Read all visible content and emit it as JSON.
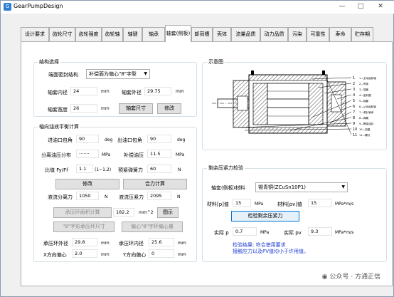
{
  "window": {
    "title": "GearPumpDesign"
  },
  "tabs": [
    "设计要求",
    "齿轮尺寸",
    "齿轮强度",
    "齿轮轴",
    "轴键",
    "轴承",
    "轴套(侧板)",
    "卸荷槽",
    "壳体",
    "流量品质",
    "动力品质",
    "污染",
    "可靠性",
    "寿命",
    "贮存期"
  ],
  "active_tab": "轴套(侧板)",
  "structure": {
    "title": "结构选择",
    "seal_label": "端面密封结构",
    "seal_value": "补偿面为偏心\"8\"字型",
    "inner_diameter_label": "轴套内径",
    "inner_diameter_value": "24",
    "inner_diameter_unit": "mm",
    "outer_diameter_label": "轴套外径",
    "outer_diameter_value": "29.75",
    "outer_diameter_unit": "mm",
    "width_label": "轴套宽度",
    "width_value": "26",
    "width_unit": "mm",
    "size_button": "轴套尺寸",
    "modify_button": "修改"
  },
  "balance": {
    "title": "轴向油液平衡计算",
    "inlet_angle_label": "进油口包角",
    "inlet_angle_value": "90",
    "inlet_angle_unit": "deg",
    "outlet_angle_label": "出油口包角",
    "outlet_angle_value": "90",
    "outlet_angle_unit": "deg",
    "dist_label": "分离油压分布",
    "dist_value": "·······",
    "dist_unit": "MPa",
    "comp_pressure_label": "补偿油压",
    "comp_pressure_value": "11.5",
    "comp_pressure_unit": "MPa",
    "ratio_label": "比值  Fy/Ff",
    "ratio_value": "1.1",
    "ratio_range": "(1~1.2)",
    "spring_label": "预紧弹簧力",
    "spring_value": "60",
    "spring_unit": "N",
    "modify_button": "修改",
    "calc_button": "合力计算",
    "sep_force_label": "液流分离力",
    "sep_force_value": "1050",
    "sep_force_unit": "N",
    "press_force_label": "液流压紧力",
    "press_force_value": "2095",
    "press_force_unit": "N",
    "area_button": "承压环面积计算",
    "area_value": "182.2",
    "area_unit": "mm^2",
    "diagram_button": "图示",
    "ring_button": "\"8\"字形承压环尺寸",
    "ecc_button": "偏心\"8\"字环偏心量",
    "ring_outer_label": "承压环外径",
    "ring_outer_value": "29.8",
    "ring_inner_label": "承压环内径",
    "ring_inner_value": "25.6",
    "x_ecc_label": "X方向偏心",
    "x_ecc_value": "2.0",
    "y_ecc_label": "Y方向偏心",
    "y_ecc_value": "0",
    "unit_mm": "mm"
  },
  "schematic": {
    "title": "示意图",
    "callouts": [
      "1",
      "2",
      "3",
      "4",
      "5",
      "6",
      "7",
      "8",
      "9",
      "10",
      "11"
    ],
    "legend": [
      "1—主动齿轮轴",
      "2—壳体",
      "3—端盖",
      "4—密封圈",
      "5—轴套",
      "6—从动齿轮轴",
      "7—滚针轴承",
      "8—弹簧",
      "9—骨架油封",
      "10—挡圈",
      "11—螺钉"
    ]
  },
  "pv_check": {
    "title": "剩余压紧力检验",
    "material_label": "轴套(侧板)材料",
    "material_value": "锡青铜(ZCuSn10P1)",
    "allow_p_label": "材料[p]值",
    "allow_p_value": "15",
    "allow_p_unit": "MPa",
    "allow_pv_label": "材料[pv]值",
    "allow_pv_value": "15",
    "allow_pv_unit": "MPa*m/s",
    "check_button": "检验剩余压紧力",
    "actual_p_label": "实际  p",
    "actual_p_value": "0.7",
    "actual_p_unit": "MPa",
    "actual_pv_label": "实际  pv",
    "actual_pv_value": "9.3",
    "actual_pv_unit": "MPa*m/s",
    "result_line1": "检验结果: 符合使用要求",
    "result_line2": "接触应力以及PV值均小于许用值。"
  },
  "watermark": "公众号 · 方通正信"
}
